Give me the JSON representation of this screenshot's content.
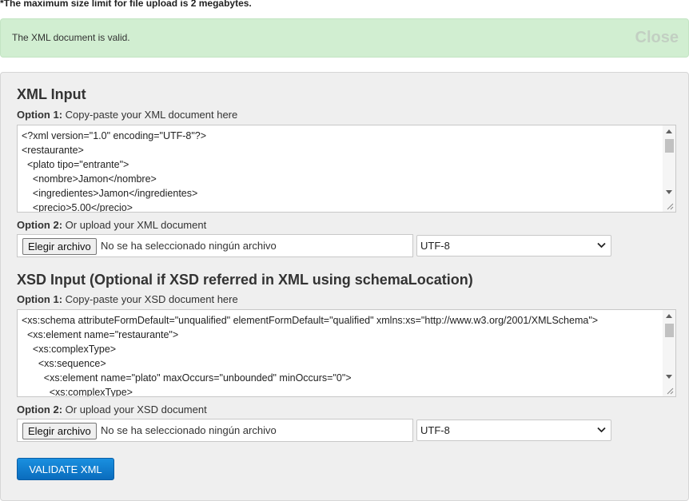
{
  "upload_note": "*The maximum size limit for file upload is 2 megabytes.",
  "alert": {
    "message": "The XML document is valid.",
    "close_label": "Close",
    "color": "#d1eed1"
  },
  "xml_section": {
    "title": "XML Input",
    "option1_prefix": "Option 1:",
    "option1_text": " Copy-paste your XML document here",
    "code": "<?xml version=\"1.0\" encoding=\"UTF-8\"?>\n<restaurante>\n  <plato tipo=\"entrante\">\n    <nombre>Jamon</nombre>\n    <ingredientes>Jamon</ingredientes>\n    <precio>5.00</precio>",
    "option2_prefix": "Option 2:",
    "option2_text": " Or upload your XML document",
    "file_button": "Elegir archivo",
    "file_status": "No se ha seleccionado ningún archivo",
    "encoding": "UTF-8"
  },
  "xsd_section": {
    "title": "XSD Input (Optional if XSD referred in XML using schemaLocation)",
    "option1_prefix": "Option 1:",
    "option1_text": " Copy-paste your XSD document here",
    "code": "<xs:schema attributeFormDefault=\"unqualified\" elementFormDefault=\"qualified\" xmlns:xs=\"http://www.w3.org/2001/XMLSchema\">\n  <xs:element name=\"restaurante\">\n    <xs:complexType>\n      <xs:sequence>\n        <xs:element name=\"plato\" maxOccurs=\"unbounded\" minOccurs=\"0\">\n          <xs:complexType>",
    "option2_prefix": "Option 2:",
    "option2_text": " Or upload your XSD document",
    "file_button": "Elegir archivo",
    "file_status": "No se ha seleccionado ningún archivo",
    "encoding": "UTF-8"
  },
  "validate_button": "VALIDATE XML",
  "accent_color": "#0a6cbd"
}
